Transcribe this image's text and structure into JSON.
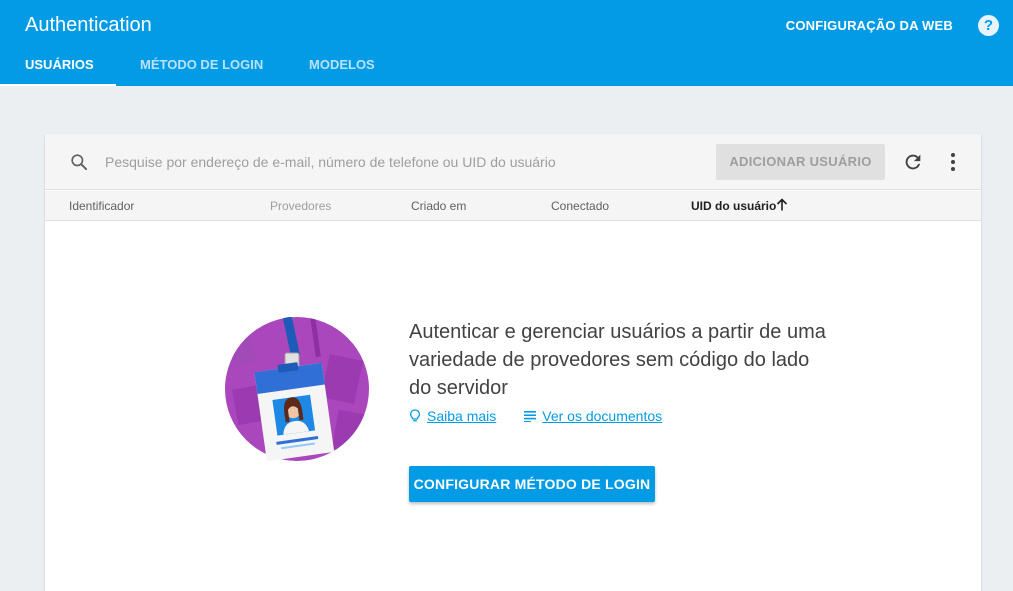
{
  "header": {
    "title": "Authentication",
    "web_config_label": "CONFIGURAÇÃO DA WEB",
    "help_icon": "help-icon",
    "help_glyph": "?"
  },
  "tabs": [
    {
      "label": "USUÁRIOS",
      "active": true
    },
    {
      "label": "MÉTODO DE LOGIN",
      "active": false
    },
    {
      "label": "MODELOS",
      "active": false
    }
  ],
  "toolbar": {
    "search_icon": "search-icon",
    "search_placeholder": "Pesquise por endereço de e-mail, número de telefone ou UID do usuário",
    "search_value": "",
    "add_user_label": "ADICIONAR USUÁRIO",
    "refresh_icon": "refresh-icon",
    "more_icon": "more-vert-icon"
  },
  "table": {
    "columns": [
      "Identificador",
      "Provedores",
      "Criado em",
      "Conectado",
      "UID do usuário"
    ],
    "sorted_column": "UID do usuário",
    "sort_direction": "ascending",
    "sort_icon": "arrow-up-icon"
  },
  "empty_state": {
    "illustration": "id-badge-illustration",
    "message": "Autenticar e gerenciar usuários a partir de uma variedade de provedores sem código do lado do servidor",
    "learn_more_icon": "lightbulb-icon",
    "learn_more_label": "Saiba mais",
    "docs_icon": "notes-icon",
    "docs_label": "Ver os documentos",
    "cta_label": "CONFIGURAR MÉTODO DE LOGIN"
  },
  "colors": {
    "brand_blue": "#039be5",
    "background": "#eceff1",
    "disabled_button": "#e0e0e0"
  }
}
